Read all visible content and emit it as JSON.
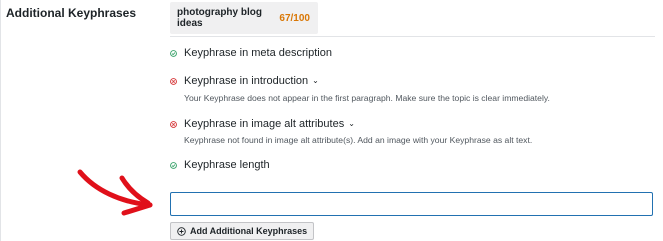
{
  "section_label": "Additional Keyphrases",
  "tab": {
    "keyphrase": "photography blog ideas",
    "score": "67/100"
  },
  "checks": [
    {
      "label": "Keyphrase in meta description",
      "status": "good",
      "description": "",
      "expandable": false
    },
    {
      "label": "Keyphrase in introduction",
      "status": "bad",
      "description": "Your Keyphrase does not appear in the first paragraph. Make sure the topic is clear immediately.",
      "expandable": true
    },
    {
      "label": "Keyphrase in image alt attributes",
      "status": "bad",
      "description": "Keyphrase not found in image alt attribute(s). Add an image with your Keyphrase as alt text.",
      "expandable": true
    },
    {
      "label": "Keyphrase length",
      "status": "good",
      "description": "",
      "expandable": false
    }
  ],
  "keyphrase_input": {
    "value": "",
    "placeholder": ""
  },
  "add_button": {
    "label": "Add Additional Keyphrases",
    "icon": "plus-circle-icon"
  },
  "colors": {
    "good": "#3aa36b",
    "bad": "#d63638",
    "score": "#d97706",
    "focus": "#2271b1",
    "arrow": "#e0101a"
  }
}
